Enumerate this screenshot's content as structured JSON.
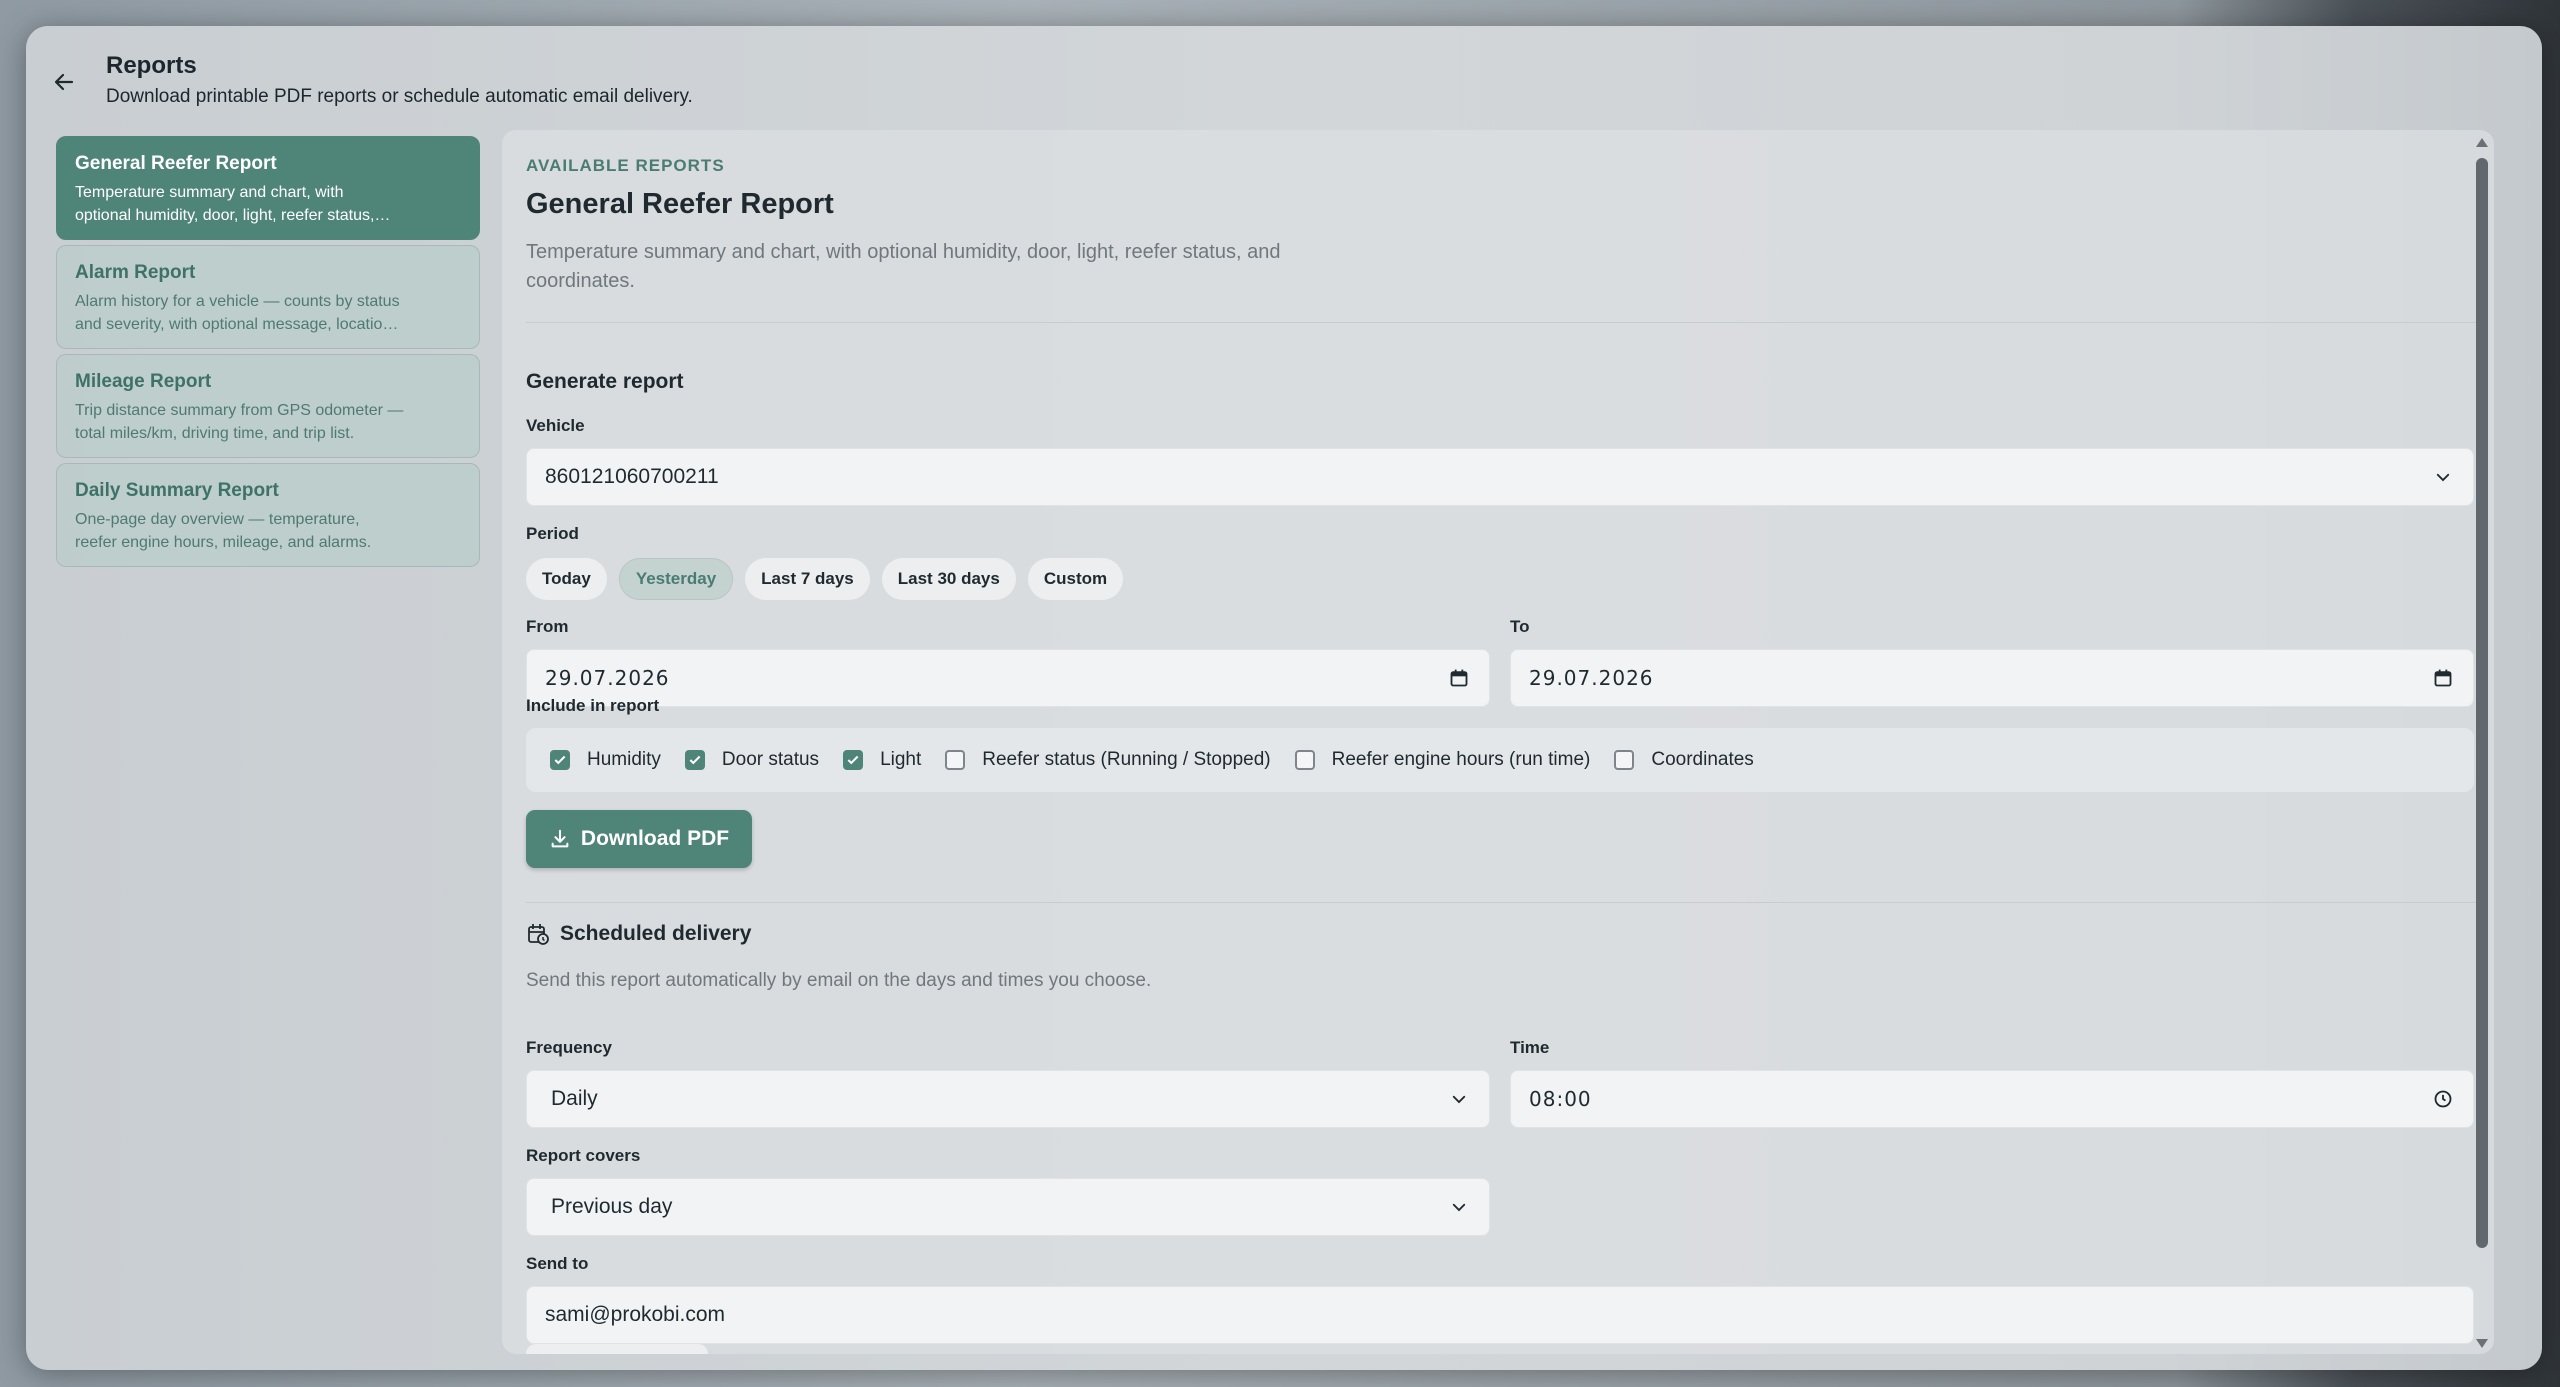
{
  "header": {
    "title": "Reports",
    "subtitle": "Download printable PDF reports or schedule automatic email delivery."
  },
  "sidebar": {
    "items": [
      {
        "title": "General Reefer Report",
        "desc": "Temperature summary and chart, with\noptional humidity, door, light, reefer status,…"
      },
      {
        "title": "Alarm Report",
        "desc": "Alarm history for a vehicle — counts by status\nand severity, with optional message, locatio…"
      },
      {
        "title": "Mileage Report",
        "desc": "Trip distance summary from GPS odometer —\ntotal miles/km, driving time, and trip list."
      },
      {
        "title": "Daily Summary Report",
        "desc": "One-page day overview — temperature,\nreefer engine hours, mileage, and alarms."
      }
    ]
  },
  "main": {
    "kicker": "AVAILABLE REPORTS",
    "title": "General Reefer Report",
    "desc": "Temperature summary and chart, with optional humidity, door, light, reefer status, and coordinates.",
    "generate_label": "Generate report",
    "vehicle_label": "Vehicle",
    "vehicle_value": "860121060700211",
    "period_label": "Period",
    "period_options": [
      "Today",
      "Yesterday",
      "Last 7 days",
      "Last 30 days",
      "Custom"
    ],
    "from_label": "From",
    "from_value": "29.07.2026",
    "to_label": "To",
    "to_value": "29.07.2026",
    "include_label": "Include in report",
    "include": [
      {
        "label": "Humidity",
        "checked": true
      },
      {
        "label": "Door status",
        "checked": true
      },
      {
        "label": "Light",
        "checked": true
      },
      {
        "label": "Reefer status (Running / Stopped)",
        "checked": false
      },
      {
        "label": "Reefer engine hours (run time)",
        "checked": false
      },
      {
        "label": "Coordinates",
        "checked": false
      }
    ],
    "download_label": "Download PDF",
    "scheduled": {
      "title": "Scheduled delivery",
      "desc": "Send this report automatically by email on the days and times you choose.",
      "frequency_label": "Frequency",
      "frequency_value": "Daily",
      "time_label": "Time",
      "time_value": "08:00",
      "covers_label": "Report covers",
      "covers_value": "Previous day",
      "sendto_label": "Send to",
      "sendto_value": "sami@prokobi.com"
    }
  },
  "colors": {
    "accent": "#4f8479",
    "accent_text": "#4a7c73"
  }
}
